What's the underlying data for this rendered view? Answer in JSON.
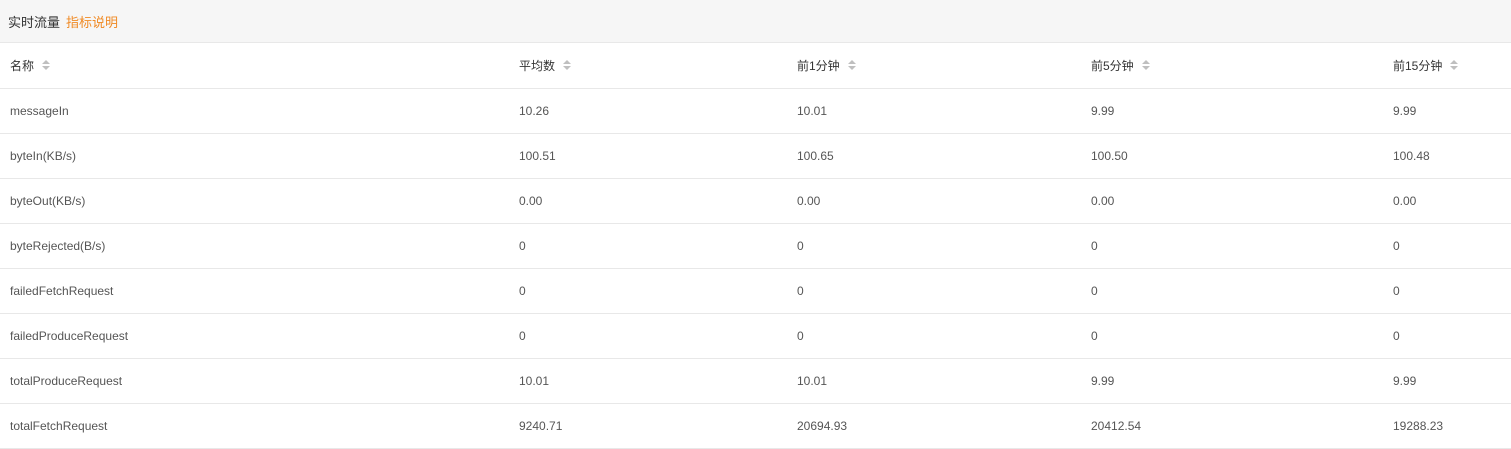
{
  "header": {
    "title": "实时流量",
    "link": "指标说明"
  },
  "table": {
    "columns": [
      "名称",
      "平均数",
      "前1分钟",
      "前5分钟",
      "前15分钟"
    ],
    "rows": [
      [
        "messageIn",
        "10.26",
        "10.01",
        "9.99",
        "9.99"
      ],
      [
        "byteIn(KB/s)",
        "100.51",
        "100.65",
        "100.50",
        "100.48"
      ],
      [
        "byteOut(KB/s)",
        "0.00",
        "0.00",
        "0.00",
        "0.00"
      ],
      [
        "byteRejected(B/s)",
        "0",
        "0",
        "0",
        "0"
      ],
      [
        "failedFetchRequest",
        "0",
        "0",
        "0",
        "0"
      ],
      [
        "failedProduceRequest",
        "0",
        "0",
        "0",
        "0"
      ],
      [
        "totalProduceRequest",
        "10.01",
        "10.01",
        "9.99",
        "9.99"
      ],
      [
        "totalFetchRequest",
        "9240.71",
        "20694.93",
        "20412.54",
        "19288.23"
      ]
    ]
  },
  "colors": {
    "accent": "#f08a24",
    "header_bg": "#f6f6f6",
    "border": "#e8e8e8",
    "sort_icon": "#bfbfbf"
  },
  "icons": {
    "sort": "sort-icon"
  }
}
